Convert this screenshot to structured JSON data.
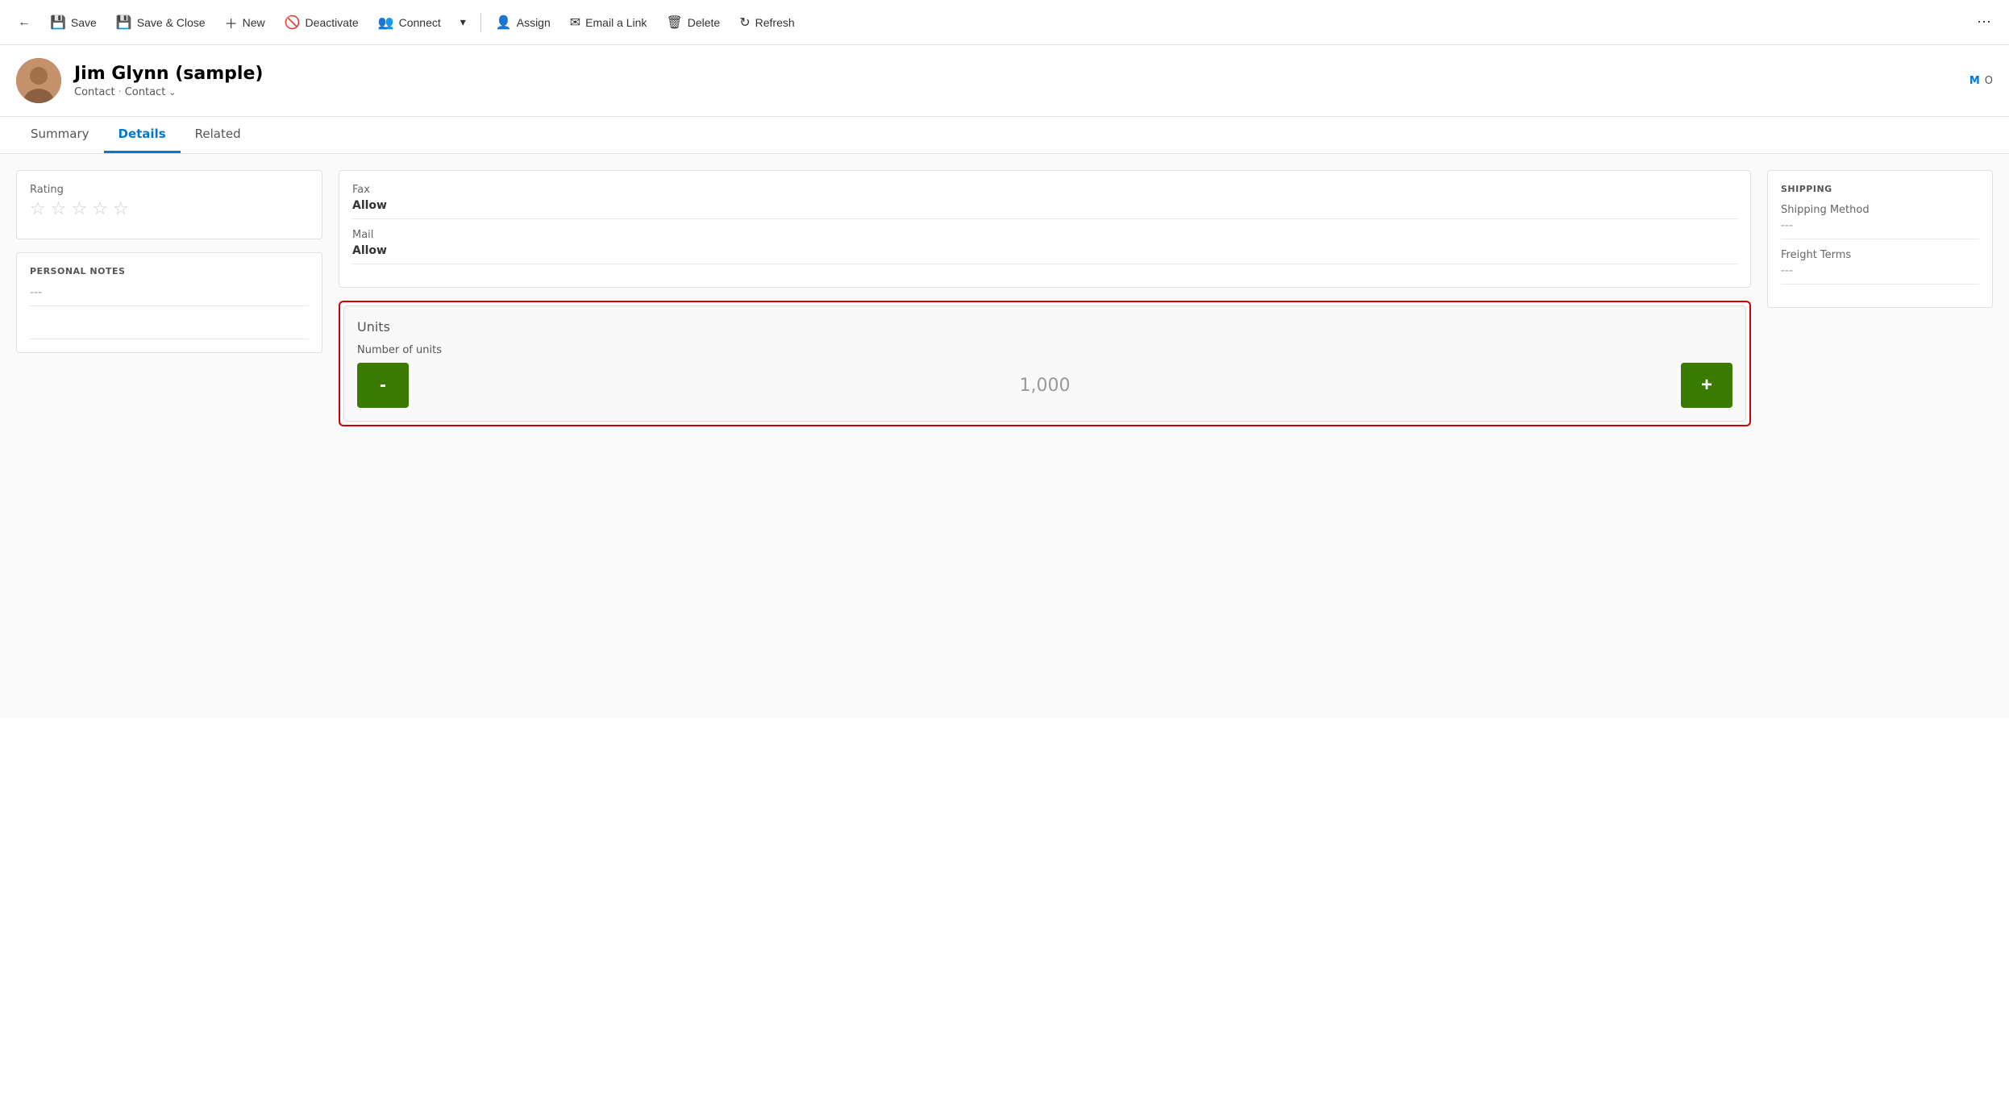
{
  "toolbar": {
    "back_label": "←",
    "save_label": "Save",
    "save_close_label": "Save & Close",
    "new_label": "New",
    "deactivate_label": "Deactivate",
    "connect_label": "Connect",
    "dropdown_label": "▾",
    "assign_label": "Assign",
    "email_link_label": "Email a Link",
    "delete_label": "Delete",
    "refresh_label": "Refresh",
    "more_label": "⋯"
  },
  "header": {
    "name": "Jim Glynn (sample)",
    "type1": "Contact",
    "dot": "·",
    "type2": "Contact",
    "chevron": "⌄",
    "initials": "M",
    "initials2": "O"
  },
  "tabs": [
    {
      "label": "Summary",
      "active": false
    },
    {
      "label": "Details",
      "active": true
    },
    {
      "label": "Related",
      "active": false
    }
  ],
  "left": {
    "rating_section": {
      "field_label": "Rating",
      "stars": [
        "☆",
        "☆",
        "☆",
        "☆",
        "☆"
      ]
    },
    "personal_notes_section": {
      "title": "PERSONAL NOTES",
      "value": "---"
    }
  },
  "middle": {
    "contact_prefs": {
      "fax_label": "Fax",
      "fax_perm_label": "Allow",
      "mail_label": "Mail",
      "mail_perm_label": "Allow"
    },
    "units": {
      "title": "Units",
      "field_label": "Number of units",
      "value": "1,000",
      "minus_label": "-",
      "plus_label": "+"
    }
  },
  "right": {
    "shipping": {
      "title": "SHIPPING",
      "method_label": "Shipping Method",
      "method_value": "---",
      "terms_label": "Freight Terms",
      "terms_value": "---"
    }
  }
}
